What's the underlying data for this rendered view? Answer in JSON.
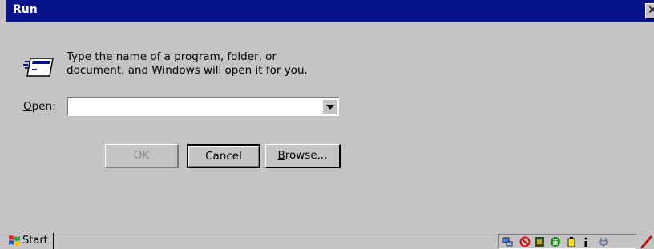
{
  "window": {
    "title": "Run",
    "close_glyph": "✕"
  },
  "dialog": {
    "prompt_line1": "Type the name of a program, folder, or",
    "prompt_line2": "document, and Windows will open it for you.",
    "open_label_accel": "O",
    "open_label_rest": "pen:",
    "open_value": "",
    "buttons": {
      "ok": "OK",
      "cancel": "Cancel",
      "browse_accel": "B",
      "browse_rest": "rowse..."
    }
  },
  "taskbar": {
    "start_label": "Start",
    "tray_icons": [
      "network-icon",
      "no-connection-icon",
      "app-icon",
      "language-icon",
      "battery-icon",
      "info-icon",
      "power-icon"
    ],
    "pen_icon": "pen-icon"
  },
  "colors": {
    "titlebar": "#08148c",
    "face": "#c6c3c6",
    "disabled_text": "#8c8a8c"
  }
}
